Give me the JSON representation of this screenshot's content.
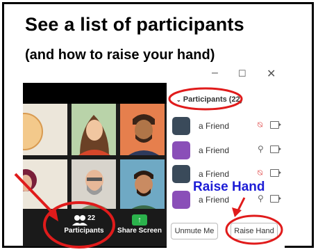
{
  "heading": {
    "title": "See a list of participants",
    "subtitle": "(and how to raise your hand)"
  },
  "window_controls": {
    "minimize": "–",
    "maximize": "☐",
    "close": "✕"
  },
  "toolbar": {
    "participants_label": "Participants",
    "participants_count": "22",
    "share_label": "Share Screen",
    "share_color": "#2bb24c"
  },
  "panel": {
    "title": "Participants (22)",
    "rows": [
      {
        "name": "a Friend",
        "avatar_color": "#3a4a5a",
        "mic": "muted"
      },
      {
        "name": "a Friend",
        "avatar_color": "#8a4fb8",
        "mic": "on"
      },
      {
        "name": "a Friend",
        "avatar_color": "#3a4a5a",
        "mic": "muted"
      },
      {
        "name": "a Friend",
        "avatar_color": "#8a4fb8",
        "mic": "on"
      }
    ],
    "unmute_label": "Unmute Me",
    "raise_label": "Raise Hand"
  },
  "annotation": {
    "raise_hand_label": "Raise Hand",
    "highlight_color": "#e01b1b",
    "label_color": "#1c1cd6"
  }
}
